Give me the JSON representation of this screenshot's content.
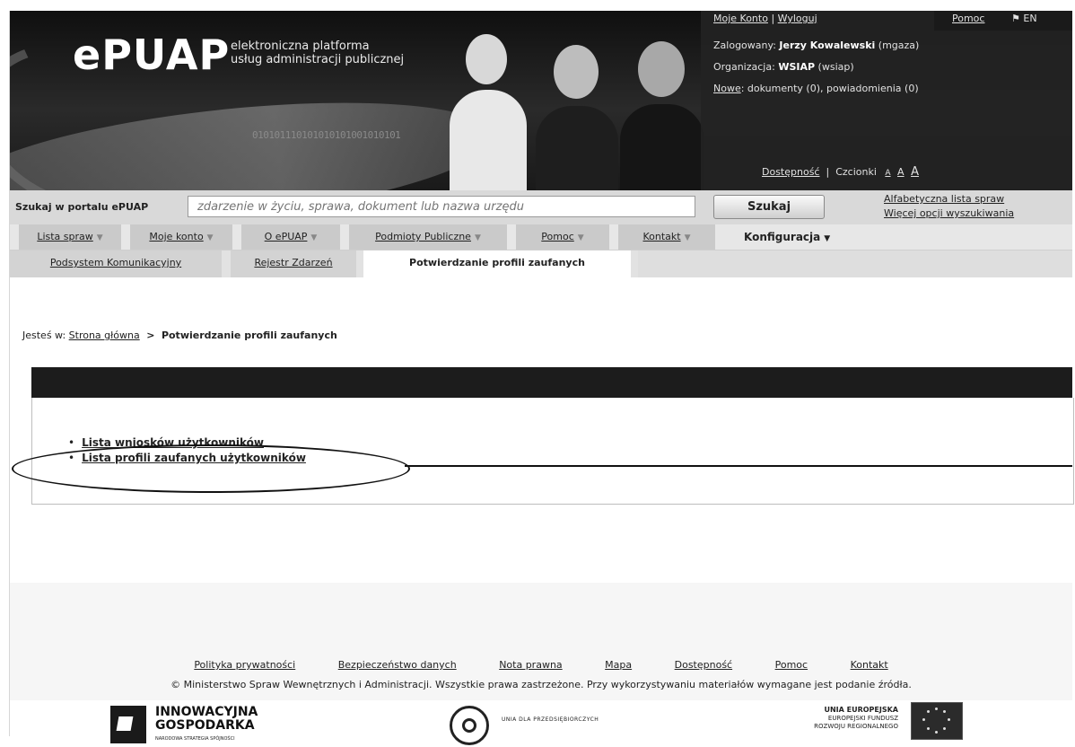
{
  "header": {
    "logo": "ePUAP",
    "tagline_line1": "elektroniczna platforma",
    "tagline_line2": "usług administracji publicznej",
    "binary": "010101110101010101001010101",
    "top_links": {
      "account": "Moje Konto",
      "logout": "Wyloguj",
      "help": "Pomoc",
      "lang": "EN"
    },
    "user_label": "Zalogowany:",
    "user_name": "Jerzy Kowalewski",
    "user_login": "(mgaza)",
    "org_label": "Organizacja:",
    "org_name": "WSIAP",
    "org_code": "(wsiap)",
    "new_label": "Nowe",
    "new_text": ": dokumenty (0), powiadomienia (0)",
    "accessibility": "Dostępność",
    "fonts_label": "Czcionki",
    "font_sizes": [
      "A",
      "A",
      "A"
    ]
  },
  "search": {
    "label": "Szukaj w portalu ePUAP",
    "placeholder": "zdarzenie w życiu, sprawa, dokument lub nazwa urzędu",
    "button": "Szukaj",
    "link_alpha": "Alfabetyczna lista spraw",
    "link_more": "Więcej opcji wyszukiwania"
  },
  "menu": {
    "items": [
      {
        "label": "Lista spraw"
      },
      {
        "label": "Moje konto"
      },
      {
        "label": "O ePUAP"
      },
      {
        "label": "Podmioty Publiczne"
      },
      {
        "label": "Pomoc"
      },
      {
        "label": "Kontakt"
      },
      {
        "label": "Konfiguracja"
      }
    ]
  },
  "submenu": {
    "items": [
      {
        "label": "Podsystem Komunikacyjny"
      },
      {
        "label": "Rejestr Zdarzeń"
      },
      {
        "label": "Potwierdzanie profili zaufanych"
      }
    ]
  },
  "breadcrumb": {
    "prefix": "Jesteś w:",
    "home": "Strona główna",
    "separator": ">",
    "current": "Potwierdzanie profili zaufanych"
  },
  "content": {
    "links": [
      {
        "label": "Lista wniosków użytkowników"
      },
      {
        "label": "Lista profili zaufanych użytkowników"
      }
    ]
  },
  "footer": {
    "links": [
      "Polityka prywatności",
      "Bezpieczeństwo danych",
      "Nota prawna",
      "Mapa",
      "Dostępność",
      "Pomoc",
      "Kontakt"
    ],
    "copyright": "© Ministerstwo Spraw Wewnętrznych i Administracji. Wszystkie prawa zastrzeżone. Przy wykorzystywaniu materiałów wymagane jest podanie źródła.",
    "logo_ig_line1": "INNOWACYJNA",
    "logo_ig_line2": "GOSPODARKA",
    "logo_ig_small": "NARODOWA STRATEGIA SPÓJNOŚCI",
    "logo_mid": "UNIA DLA PRZEDSIĘBIORCZYCH",
    "logo_eu_line1": "UNIA EUROPEJSKA",
    "logo_eu_line2": "EUROPEJSKI FUNDUSZ",
    "logo_eu_line3": "ROZWOJU REGIONALNEGO"
  }
}
